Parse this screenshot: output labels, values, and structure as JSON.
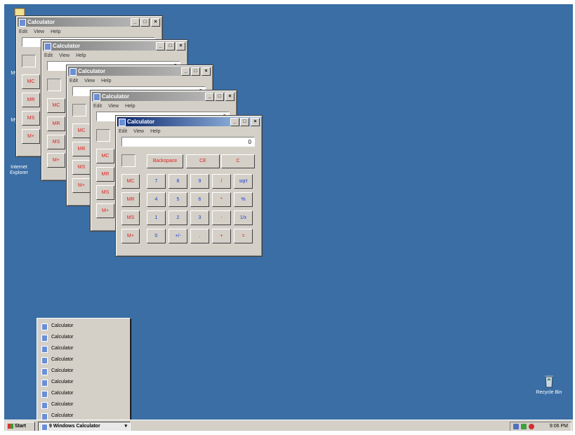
{
  "desktop": {
    "icons": [
      {
        "label": "My"
      },
      {
        "label": "My"
      },
      {
        "label": "My"
      },
      {
        "label": "Internet Explorer"
      },
      {
        "label": "Recycle Bin"
      }
    ]
  },
  "window": {
    "title": "Calculator",
    "menu": [
      "Edit",
      "View",
      "Help"
    ],
    "display_value": "0",
    "buttons": {
      "min": "_",
      "max": "□",
      "close": "×"
    },
    "keys": {
      "backspace": "Backspace",
      "ce": "CE",
      "c": "C",
      "mc": "MC",
      "mr": "MR",
      "ms": "MS",
      "mplus": "M+",
      "digits": [
        "7",
        "8",
        "9",
        "4",
        "5",
        "6",
        "1",
        "2",
        "3",
        "0"
      ],
      "plusminus": "+/-",
      "dot": ".",
      "div": "/",
      "mul": "*",
      "sub": "-",
      "add": "+",
      "sqrt": "sqrt",
      "pct": "%",
      "recip": "1/x",
      "eq": "="
    }
  },
  "taskbar": {
    "start_label": "Start",
    "group_label": "9 Windows Calculator",
    "group_arrow": "▾",
    "clock": "9:06 PM",
    "group_items": [
      "Calculator",
      "Calculator",
      "Calculator",
      "Calculator",
      "Calculator",
      "Calculator",
      "Calculator",
      "Calculator",
      "Calculator"
    ]
  },
  "colors": {
    "desktop": "#3a6ea5",
    "active_title": "#0a246a",
    "inactive_title": "#808080",
    "key_red": "#e02020",
    "key_blue": "#1a3fd0"
  }
}
